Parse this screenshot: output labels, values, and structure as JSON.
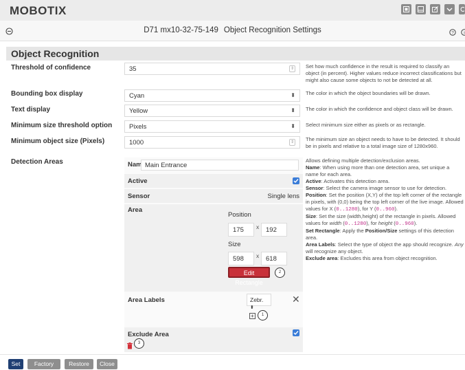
{
  "brand": {
    "logo": "MOBOTIX"
  },
  "header": {
    "camera": "D71 mx10-32-75-149",
    "title": "Object Recognition Settings"
  },
  "section": {
    "title": "Object Recognition"
  },
  "fields": {
    "threshold": {
      "label": "Threshold of confidence",
      "value": "35",
      "desc": "Set how much confidence in the result is required to classify an object (in percent). Higher values reduce incorrect classifications but might also cause some objects to not be detected at all."
    },
    "bbox": {
      "label": "Bounding box display",
      "value": "Cyan",
      "desc": "The color in which the object boundaries will be drawn."
    },
    "text": {
      "label": "Text display",
      "value": "Yellow",
      "desc": "The color in which the confidence and object class will be drawn."
    },
    "minopt": {
      "label": "Minimum size threshold option",
      "value": "Pixels",
      "desc": "Select minimum size either as pixels or as rectangle."
    },
    "minsize": {
      "label": "Minimum object size (Pixels)",
      "value": "1000",
      "desc": "The minimum size an object needs to have to be detected. It should be in pixels and relative to a total image size of 1280x960."
    }
  },
  "detection": {
    "label": "Detection Areas",
    "name_label": "Name",
    "name_value": "Main Entrance",
    "active_label": "Active",
    "sensor_label": "Sensor",
    "sensor_value": "Single lens",
    "area_label": "Area",
    "position_label": "Position",
    "pos_x": "175",
    "pos_y": "192",
    "size_label": "Size",
    "size_w": "598",
    "size_h": "618",
    "x_sep": "x",
    "edit_button": "Edit Rectangle",
    "area_labels_label": "Area Labels",
    "area_labels_value": "Zebr.",
    "exclude_label": "Exclude Area",
    "callout_edit": "2",
    "callout_add": "1",
    "callout_delete": "3",
    "desc": {
      "intro": "Allows defining multiple detection/exclusion areas.",
      "name_k": "Name",
      "name_t": ": When using more than one detection area, set unique a name for each area.",
      "active_k": "Active",
      "active_t": ": Activates this detection area.",
      "sensor_k": "Sensor",
      "sensor_t": ": Select the camera image sensor to use for detection.",
      "position_k": "Position",
      "position_t": ": Set the position (X,Y) of the top left corner of the rectangle in pixels, with (0,0) being the top left corner of the live image. Allowed values for X (",
      "range_x": "0..1280",
      "mid_for_y": "), for Y (",
      "range_y": "0..960",
      "end_paren": ").",
      "size_k": "Size",
      "size_t": ": Set the size (width,height) of the rectangle in pixels. Allowed values for ",
      "width_word": "width",
      "open_paren": " (",
      "range_w": "0..1280",
      "for_height": "), for ",
      "height_word": "height",
      "range_h": "0..960",
      "setrect_k": "Set Rectangle",
      "setrect_t1": ": Apply the ",
      "setrect_b": "Position/Size",
      "setrect_t2": " settings of this detection area.",
      "labels_k": "Area Labels",
      "labels_t1": ": Select the type of object the app should recognize. ",
      "labels_any": "Any",
      "labels_t2": " will recognize any object.",
      "exclude_k": "Exclude area",
      "exclude_t": ": Excludes this area from object recognition."
    }
  },
  "buttons": {
    "set": "Set",
    "factory": "Factory",
    "restore": "Restore",
    "close": "Close"
  },
  "colors": {
    "accent_blue": "#3b7dd8",
    "edit_red": "#c8313a",
    "set_button": "#1f3f73",
    "gray_button": "#8e8e8e"
  }
}
